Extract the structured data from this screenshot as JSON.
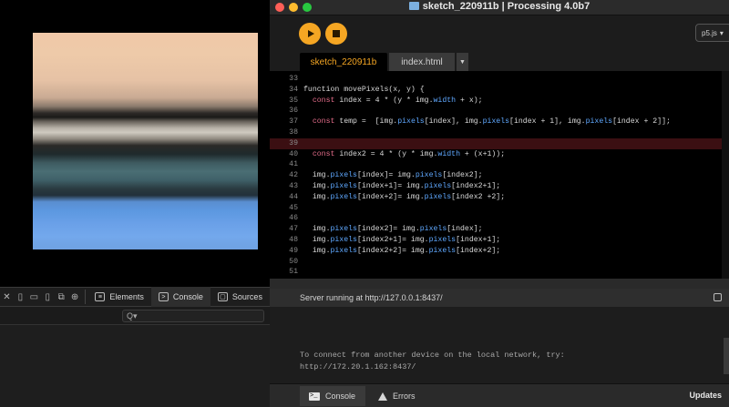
{
  "window": {
    "title": "sketch_220911b | Processing 4.0b7"
  },
  "toolbar": {
    "mode": "p5.js",
    "mode_arrow": "▾"
  },
  "tabs": {
    "sketch": "sketch_220911b",
    "index": "index.html",
    "menu": "▼"
  },
  "editor": {
    "highlight_line": 39,
    "lines": [
      {
        "n": "33",
        "segs": []
      },
      {
        "n": "34",
        "segs": [
          [
            "t",
            "function movePixels(x, y) {"
          ]
        ]
      },
      {
        "n": "35",
        "segs": [
          [
            "t",
            "  "
          ],
          [
            "k",
            "const"
          ],
          [
            "t",
            " index = 4 * (y * img."
          ],
          [
            "p",
            "width"
          ],
          [
            "t",
            " + x);"
          ]
        ]
      },
      {
        "n": "36",
        "segs": []
      },
      {
        "n": "37",
        "segs": [
          [
            "t",
            "  "
          ],
          [
            "k",
            "const"
          ],
          [
            "t",
            " temp =  [img."
          ],
          [
            "p",
            "pixels"
          ],
          [
            "t",
            "[index], img."
          ],
          [
            "p",
            "pixels"
          ],
          [
            "t",
            "[index + 1], img."
          ],
          [
            "p",
            "pixels"
          ],
          [
            "t",
            "[index + 2]];"
          ]
        ]
      },
      {
        "n": "38",
        "segs": []
      },
      {
        "n": "39",
        "segs": []
      },
      {
        "n": "40",
        "segs": [
          [
            "t",
            "  "
          ],
          [
            "k",
            "const"
          ],
          [
            "t",
            " index2 = 4 * (y * img."
          ],
          [
            "p",
            "width"
          ],
          [
            "t",
            " + (x+1));"
          ]
        ]
      },
      {
        "n": "41",
        "segs": []
      },
      {
        "n": "42",
        "segs": [
          [
            "t",
            "  img."
          ],
          [
            "p",
            "pixels"
          ],
          [
            "t",
            "[index]= img."
          ],
          [
            "p",
            "pixels"
          ],
          [
            "t",
            "[index2];"
          ]
        ]
      },
      {
        "n": "43",
        "segs": [
          [
            "t",
            "  img."
          ],
          [
            "p",
            "pixels"
          ],
          [
            "t",
            "[index+1]= img."
          ],
          [
            "p",
            "pixels"
          ],
          [
            "t",
            "[index2+1];"
          ]
        ]
      },
      {
        "n": "44",
        "segs": [
          [
            "t",
            "  img."
          ],
          [
            "p",
            "pixels"
          ],
          [
            "t",
            "[index+2]= img."
          ],
          [
            "p",
            "pixels"
          ],
          [
            "t",
            "[index2 +2];"
          ]
        ]
      },
      {
        "n": "45",
        "segs": []
      },
      {
        "n": "46",
        "segs": []
      },
      {
        "n": "47",
        "segs": [
          [
            "t",
            "  img."
          ],
          [
            "p",
            "pixels"
          ],
          [
            "t",
            "[index2]= img."
          ],
          [
            "p",
            "pixels"
          ],
          [
            "t",
            "[index];"
          ]
        ]
      },
      {
        "n": "48",
        "segs": [
          [
            "t",
            "  img."
          ],
          [
            "p",
            "pixels"
          ],
          [
            "t",
            "[index2+1]= img."
          ],
          [
            "p",
            "pixels"
          ],
          [
            "t",
            "[index+1];"
          ]
        ]
      },
      {
        "n": "49",
        "segs": [
          [
            "t",
            "  img."
          ],
          [
            "p",
            "pixels"
          ],
          [
            "t",
            "[index2+2]= img."
          ],
          [
            "p",
            "pixels"
          ],
          [
            "t",
            "[index+2];"
          ]
        ]
      },
      {
        "n": "50",
        "segs": []
      },
      {
        "n": "51",
        "segs": []
      }
    ]
  },
  "status": {
    "message": "Server running at http://127.0.0.1:8437/"
  },
  "console": {
    "line1": "To connect from another device on the local network, try:",
    "line2": "http://172.20.1.162:8437/"
  },
  "footer": {
    "console_tab": "Console",
    "errors_tab": "Errors",
    "updates": "Updates"
  },
  "devtools": {
    "tabs": [
      {
        "label": "Elements",
        "icon": "elements-icon"
      },
      {
        "label": "Console",
        "icon": "console-icon"
      },
      {
        "label": "Sources",
        "icon": "sources-icon"
      }
    ],
    "filter_icon": "Q▾"
  },
  "colors": {
    "accent": "#f5a623",
    "keyword": "#e36d8a",
    "property": "#5fa8ff",
    "highlight_line": "#3b0f12"
  }
}
